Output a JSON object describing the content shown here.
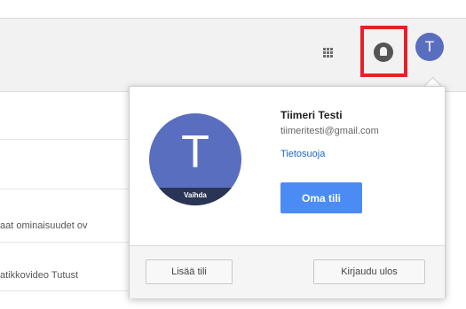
{
  "header": {
    "apps_icon": "apps-grid-icon",
    "notifications_icon": "notifications-bell-icon",
    "avatar_letter": "T",
    "highlight_color": "#e2222a"
  },
  "background": {
    "snippets": [
      "aat ominaisuudet ov",
      "atikkovideo Tutust"
    ]
  },
  "account_menu": {
    "avatar_letter": "T",
    "avatar_overlay_label": "Vaihda",
    "name": "Tiimeri Testi",
    "email": "tiimeritesti@gmail.com",
    "privacy_link": "Tietosuoja",
    "account_button": "Oma tili",
    "add_account_button": "Lisää tili",
    "sign_out_button": "Kirjaudu ulos"
  },
  "colors": {
    "avatar": "#5a6ec0",
    "primary_button": "#4b8bf4",
    "link": "#1a66c8"
  }
}
